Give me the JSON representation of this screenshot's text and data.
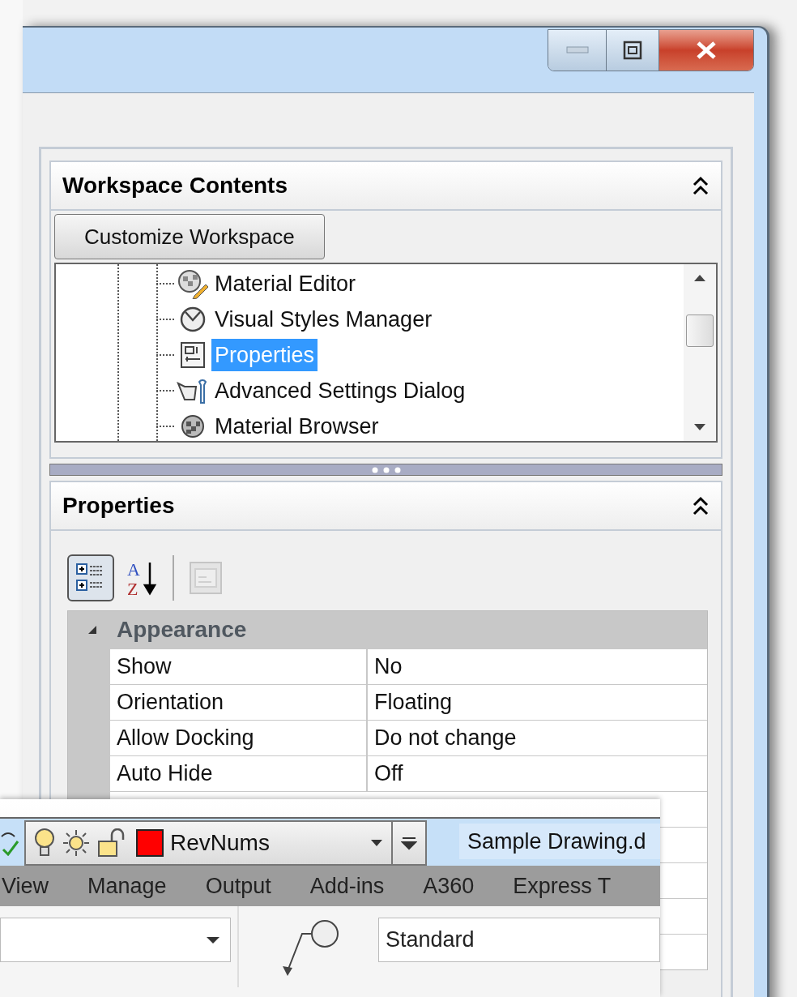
{
  "workspace_contents": {
    "title": "Workspace Contents",
    "button": "Customize Workspace",
    "tree_items": [
      {
        "label": "Material Editor",
        "kind": "material-editor",
        "selected": false
      },
      {
        "label": "Visual Styles Manager",
        "kind": "visual-styles",
        "selected": false
      },
      {
        "label": "Properties",
        "kind": "properties",
        "selected": true
      },
      {
        "label": "Advanced Settings Dialog",
        "kind": "settings",
        "selected": false
      },
      {
        "label": "Material Browser",
        "kind": "material-browser",
        "selected": false
      }
    ]
  },
  "properties": {
    "title": "Properties",
    "toolbar": [
      {
        "kind": "categorized",
        "selected": true,
        "disabled": false
      },
      {
        "kind": "alphabetical",
        "selected": false,
        "disabled": false,
        "letters": [
          "A",
          "Z"
        ]
      },
      {
        "kind": "pages",
        "selected": false,
        "disabled": true
      }
    ],
    "category": {
      "name": "Appearance",
      "expanded": true
    },
    "rows": [
      {
        "name": "Show",
        "value": "No"
      },
      {
        "name": "Orientation",
        "value": "Floating"
      },
      {
        "name": "Allow Docking",
        "value": "Do not change"
      },
      {
        "name": "Auto Hide",
        "value": "Off"
      }
    ]
  },
  "front_window": {
    "layer": {
      "name": "RevNums",
      "color": "#ff0000"
    },
    "file_tab": "Sample Drawing.d",
    "ribbon_tabs": [
      {
        "label": "View",
        "selected": false
      },
      {
        "label": "Manage",
        "selected": false
      },
      {
        "label": "Output",
        "selected": false
      },
      {
        "label": "Add-ins",
        "selected": false
      },
      {
        "label": "A360",
        "selected": false
      },
      {
        "label": "Express T",
        "selected": false
      }
    ],
    "style_field": "Standard"
  }
}
